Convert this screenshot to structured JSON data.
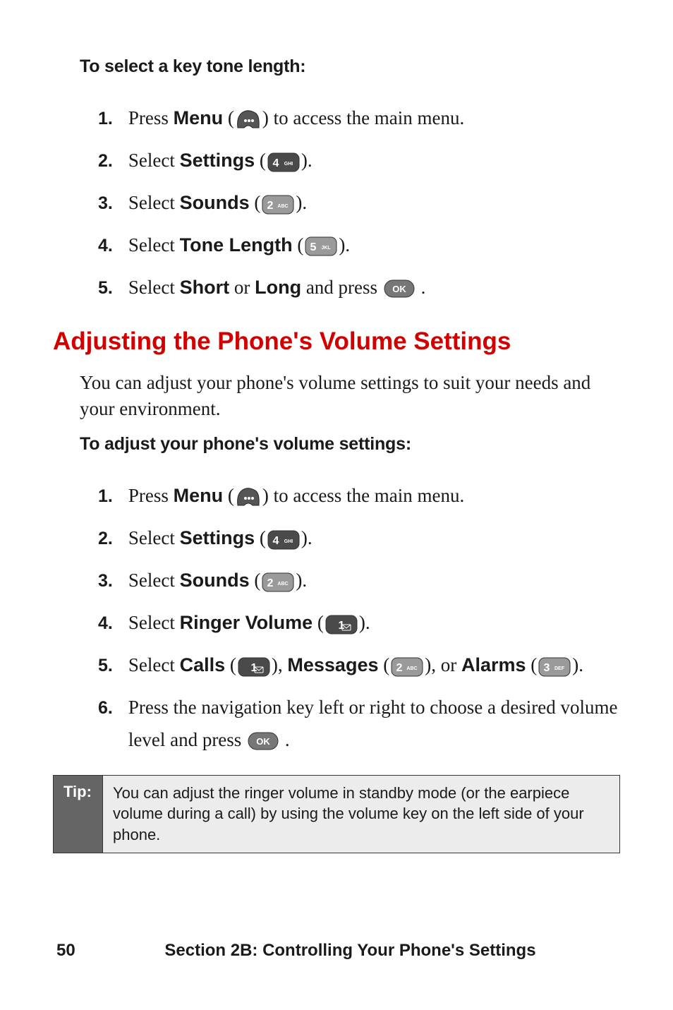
{
  "section1": {
    "heading": "To select a key tone length:",
    "steps": [
      {
        "num": "1.",
        "prefix": "Press ",
        "bold1": "Menu",
        "mid": " (",
        "icon": "menu",
        "tail": ") to access the main menu."
      },
      {
        "num": "2.",
        "prefix": "Select ",
        "bold1": "Settings",
        "mid": " (",
        "icon": "key4",
        "tail": ")."
      },
      {
        "num": "3.",
        "prefix": "Select ",
        "bold1": "Sounds",
        "mid": " (",
        "icon": "key2",
        "tail": ")."
      },
      {
        "num": "4.",
        "prefix": "Select ",
        "bold1": "Tone Length",
        "mid": " (",
        "icon": "key5",
        "tail": ")."
      },
      {
        "num": "5.",
        "prefix": "Select ",
        "bold1": "Short",
        "mid": " or ",
        "bold2": "Long",
        "mid2": " and press ",
        "icon": "ok",
        "tail": " ."
      }
    ]
  },
  "h2": "Adjusting the Phone's Volume Settings",
  "intro": "You can adjust your phone's volume settings to suit your needs and your environment.",
  "section2": {
    "heading": "To adjust your phone's volume settings:",
    "steps": [
      {
        "num": "1.",
        "prefix": "Press ",
        "bold1": "Menu",
        "mid": " (",
        "icon": "menu",
        "tail": ") to access the main menu."
      },
      {
        "num": "2.",
        "prefix": "Select ",
        "bold1": "Settings",
        "mid": " (",
        "icon": "key4",
        "tail": ")."
      },
      {
        "num": "3.",
        "prefix": "Select ",
        "bold1": "Sounds",
        "mid": " (",
        "icon": "key2",
        "tail": ")."
      },
      {
        "num": "4.",
        "prefix": "Select ",
        "bold1": "Ringer Volume",
        "mid": " (",
        "icon": "key1",
        "tail": ")."
      },
      {
        "num": "5.",
        "prefix": "Select ",
        "bold1": "Calls",
        "mid": " (",
        "icon": "key1",
        "tail1": "), ",
        "bold2": "Messages",
        "mid2": " (",
        "icon2": "key2",
        "tail2": "), or ",
        "bold3": "Alarms",
        "mid3": " (",
        "icon3": "key3",
        "tail": ")."
      },
      {
        "num": "6.",
        "prefix": "Press the navigation key left or right to choose a desired volume level and press ",
        "icon": "ok",
        "tail": " ."
      }
    ]
  },
  "tip": {
    "label": "Tip:",
    "text": "You can adjust the ringer volume in standby mode (or the earpiece volume during a call) by using the volume key on the left side of your phone."
  },
  "footer": {
    "page": "50",
    "section": "Section 2B: Controlling Your Phone's Settings"
  },
  "icons": {
    "menu": "menu",
    "key1": "1",
    "key2": "2",
    "key3": "3",
    "key4": "4",
    "key5": "5",
    "ok": "OK"
  }
}
